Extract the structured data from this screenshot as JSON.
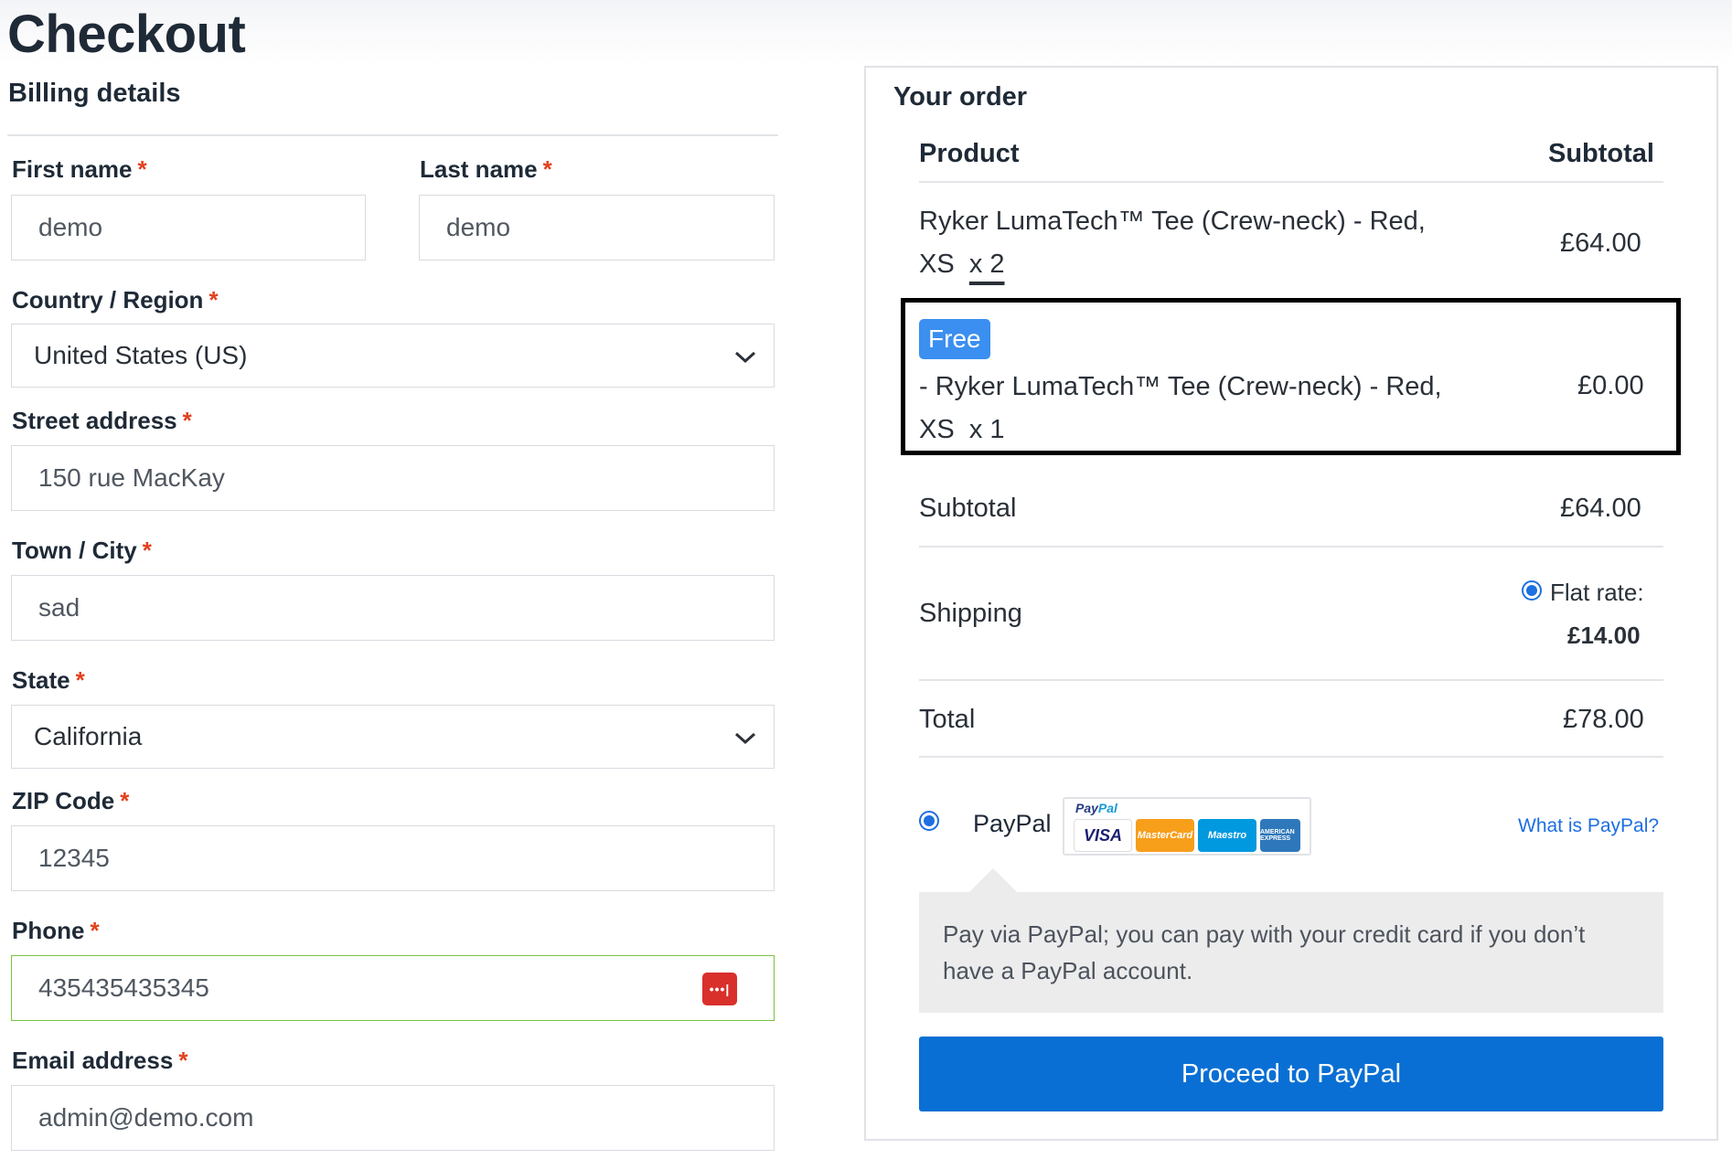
{
  "page_title": "Checkout",
  "billing": {
    "heading": "Billing details",
    "required_mark": "*",
    "first_name": {
      "label": "First name",
      "value": "demo"
    },
    "last_name": {
      "label": "Last name",
      "value": "demo"
    },
    "country": {
      "label": "Country / Region",
      "value": "United States (US)"
    },
    "street": {
      "label": "Street address",
      "value": "150 rue MacKay"
    },
    "city": {
      "label": "Town / City",
      "value": "sad"
    },
    "state": {
      "label": "State",
      "value": "California"
    },
    "zip": {
      "label": "ZIP Code",
      "value": "12345"
    },
    "phone": {
      "label": "Phone",
      "value": "435435435345",
      "autofill_badge": "•••|"
    },
    "email": {
      "label": "Email address",
      "value": "admin@demo.com"
    }
  },
  "order": {
    "heading": "Your order",
    "col_product": "Product",
    "col_subtotal": "Subtotal",
    "items": [
      {
        "name_line1": "Ryker LumaTech™ Tee (Crew-neck) - Red,",
        "name_line2": "XS",
        "qty": "x 2",
        "price": "£64.00"
      },
      {
        "badge": "Free",
        "name_line1": "- Ryker LumaTech™ Tee (Crew-neck) - Red,",
        "name_line2": "XS",
        "qty": "x 1",
        "price": "£0.00"
      }
    ],
    "subtotal_label": "Subtotal",
    "subtotal_value": "£64.00",
    "shipping_label": "Shipping",
    "shipping_method": "Flat rate:",
    "shipping_value": "£14.00",
    "total_label": "Total",
    "total_value": "£78.00"
  },
  "payment": {
    "method_label": "PayPal",
    "logo_text_pay": "Pay",
    "logo_text_pal": "Pal",
    "cards": [
      "VISA",
      "MasterCard",
      "Maestro",
      "AMERICAN EXPRESS"
    ],
    "what_is_link": "What is PayPal?",
    "description": "Pay via PayPal; you can pay with your credit card if you don’t have a PayPal account.",
    "proceed_button": "Proceed to PayPal"
  },
  "colors": {
    "accent": "#0a6fd4",
    "required": "#e2401c",
    "valid_border": "#7ac142",
    "free_badge": "#3b8ff0"
  }
}
